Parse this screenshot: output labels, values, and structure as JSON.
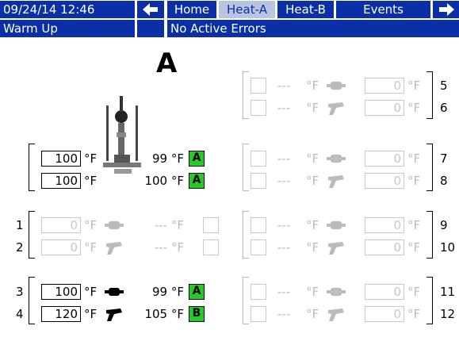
{
  "header": {
    "datetime": "09/24/14 12:46",
    "tabs": [
      {
        "label": "Home",
        "selected": false
      },
      {
        "label": "Heat-A",
        "selected": true
      },
      {
        "label": "Heat-B",
        "selected": false
      },
      {
        "label": "Events",
        "selected": false
      }
    ],
    "status_left": "Warm Up",
    "status_right": "No Active Errors",
    "back_icon": "arrow-left-icon",
    "next_icon": "arrow-right-icon"
  },
  "main": {
    "title": "A",
    "unit": "°F",
    "dashes": "---",
    "left_zones": [
      {
        "id": "primary-1",
        "label": "",
        "setpoint": "100",
        "actual": "99",
        "status": "A",
        "active": true,
        "icon": "none"
      },
      {
        "id": "primary-2",
        "label": "",
        "setpoint": "100",
        "actual": "100",
        "status": "A",
        "active": true,
        "icon": "none"
      },
      {
        "id": "zone-1",
        "label": "1",
        "setpoint": "0",
        "actual": "---",
        "status": "",
        "active": false,
        "icon": "hose-icon"
      },
      {
        "id": "zone-2",
        "label": "2",
        "setpoint": "0",
        "actual": "---",
        "status": "",
        "active": false,
        "icon": "gun-icon"
      },
      {
        "id": "zone-3",
        "label": "3",
        "setpoint": "100",
        "actual": "99",
        "status": "A",
        "active": true,
        "icon": "hose-icon"
      },
      {
        "id": "zone-4",
        "label": "4",
        "setpoint": "120",
        "actual": "105",
        "status": "B",
        "active": true,
        "icon": "gun-icon"
      }
    ],
    "right_zones": [
      {
        "label": "5",
        "setpoint": "0",
        "icon": "hose-icon"
      },
      {
        "label": "6",
        "setpoint": "0",
        "icon": "gun-icon"
      },
      {
        "label": "7",
        "setpoint": "0",
        "icon": "hose-icon"
      },
      {
        "label": "8",
        "setpoint": "0",
        "icon": "gun-icon"
      },
      {
        "label": "9",
        "setpoint": "0",
        "icon": "hose-icon"
      },
      {
        "label": "10",
        "setpoint": "0",
        "icon": "gun-icon"
      },
      {
        "label": "11",
        "setpoint": "0",
        "icon": "hose-icon"
      },
      {
        "label": "12",
        "setpoint": "0",
        "icon": "gun-icon"
      }
    ]
  },
  "colors": {
    "header_blue": "#0b2fa6",
    "selected_tab": "#b9c5e0",
    "status_green": "#22cc22",
    "inactive_gray": "#c8c8c8"
  }
}
